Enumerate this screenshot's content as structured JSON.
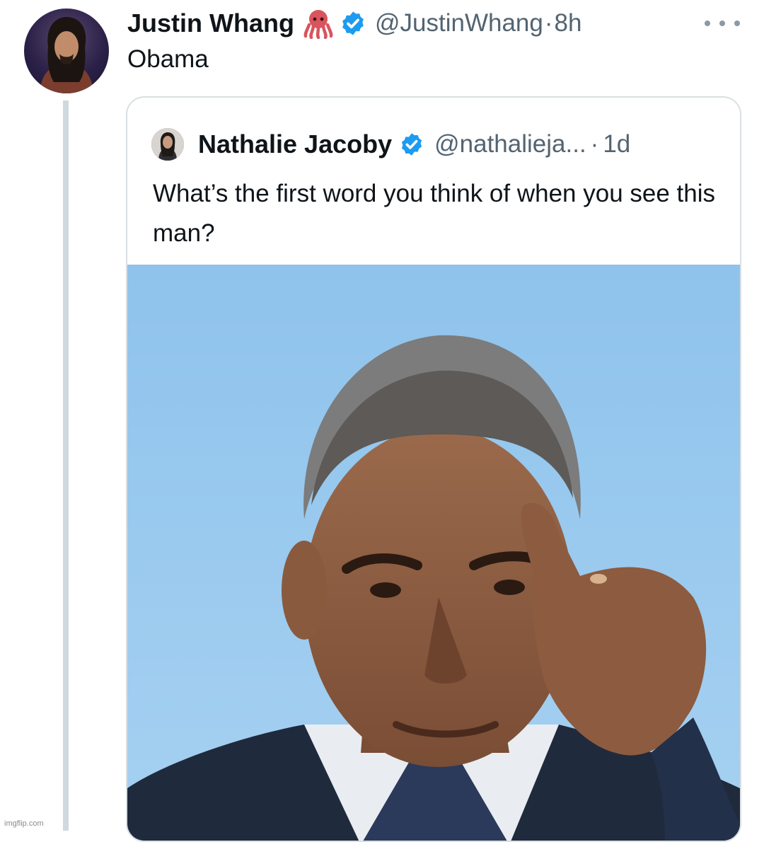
{
  "tweet": {
    "author_name": "Justin Whang",
    "author_emoji_icon": "octopus-emoji",
    "handle": "@JustinWhang",
    "separator": "·",
    "time": "8h",
    "text": "Obama",
    "more_icon": "more-horizontal-icon"
  },
  "quoted_tweet": {
    "author_name": "Nathalie Jacoby",
    "handle": "@nathalieja...",
    "separator": "·",
    "time": "1d",
    "text": "What’s the first word you think of when you see this man?",
    "image_icon": "portrait-photo"
  },
  "watermark": "imgflip.com",
  "colors": {
    "verified": "#1d9bf0",
    "secondary_text": "#536471",
    "photo_background": "#9ccbee"
  }
}
